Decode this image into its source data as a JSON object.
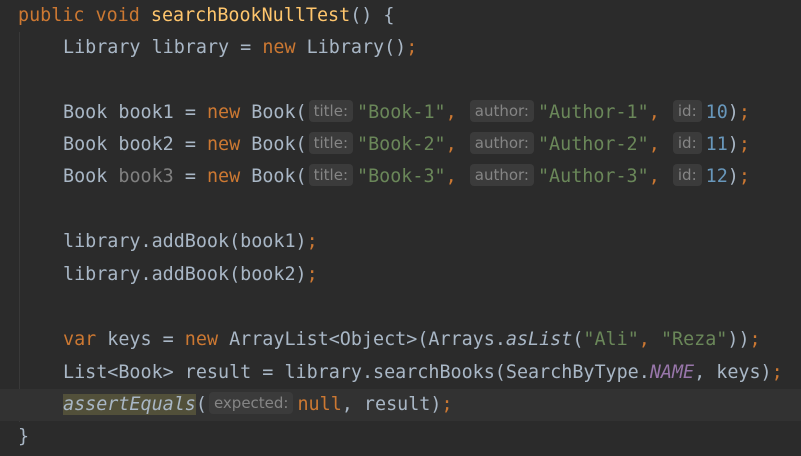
{
  "editor": {
    "method": {
      "keyword_public": "public",
      "keyword_void": "void",
      "name": "searchBookNullTest",
      "signature_rest": "() {"
    },
    "line2": {
      "type": "Library",
      "var": " library = ",
      "kw_new": "new",
      "ctor": " Library()",
      "semi": ";"
    },
    "books": [
      {
        "prefix": "Book ",
        "var": "book1",
        "assign": " = ",
        "kw_new": "new",
        "ctor": " Book(",
        "hint_title": "title:",
        "title": "\"Book-1\"",
        "comma1": ",",
        "hint_author": "author:",
        "author": "\"Author-1\"",
        "comma2": ",",
        "hint_id": "id:",
        "id": "10",
        "close": ")",
        "semi": ";"
      },
      {
        "prefix": "Book ",
        "var": "book2",
        "assign": " = ",
        "kw_new": "new",
        "ctor": " Book(",
        "hint_title": "title:",
        "title": "\"Book-2\"",
        "comma1": ",",
        "hint_author": "author:",
        "author": "\"Author-2\"",
        "comma2": ",",
        "hint_id": "id:",
        "id": "11",
        "close": ")",
        "semi": ";"
      },
      {
        "prefix": "Book ",
        "var": "book3",
        "assign": " = ",
        "kw_new": "new",
        "ctor": " Book(",
        "hint_title": "title:",
        "title": "\"Book-3\"",
        "comma1": ",",
        "hint_author": "author:",
        "author": "\"Author-3\"",
        "comma2": ",",
        "hint_id": "id:",
        "id": "12",
        "close": ")",
        "semi": ";"
      }
    ],
    "add_calls": [
      {
        "call": "library.addBook(book1)",
        "semi": ";"
      },
      {
        "call": "library.addBook(book2)",
        "semi": ";"
      }
    ],
    "keys_line": {
      "kw_var": "var",
      "mid": " keys = ",
      "kw_new": "new",
      "type": " ArrayList<Object>(Arrays.",
      "static_method": "asList",
      "open": "(",
      "arg1": "\"Ali\"",
      "sep": ", ",
      "arg2": "\"Reza\"",
      "close": "))",
      "semi": ";"
    },
    "result_line": {
      "start": "List<Book> result = library.searchBooks(SearchByType.",
      "enum_const": "NAME",
      "end": ", keys)",
      "semi": ";"
    },
    "assert_line": {
      "method": "assertEquals",
      "open": "(",
      "hint_expected": "expected:",
      "kw_null": "null",
      "rest": ", result)",
      "semi": ";"
    },
    "closing_brace": "}"
  }
}
